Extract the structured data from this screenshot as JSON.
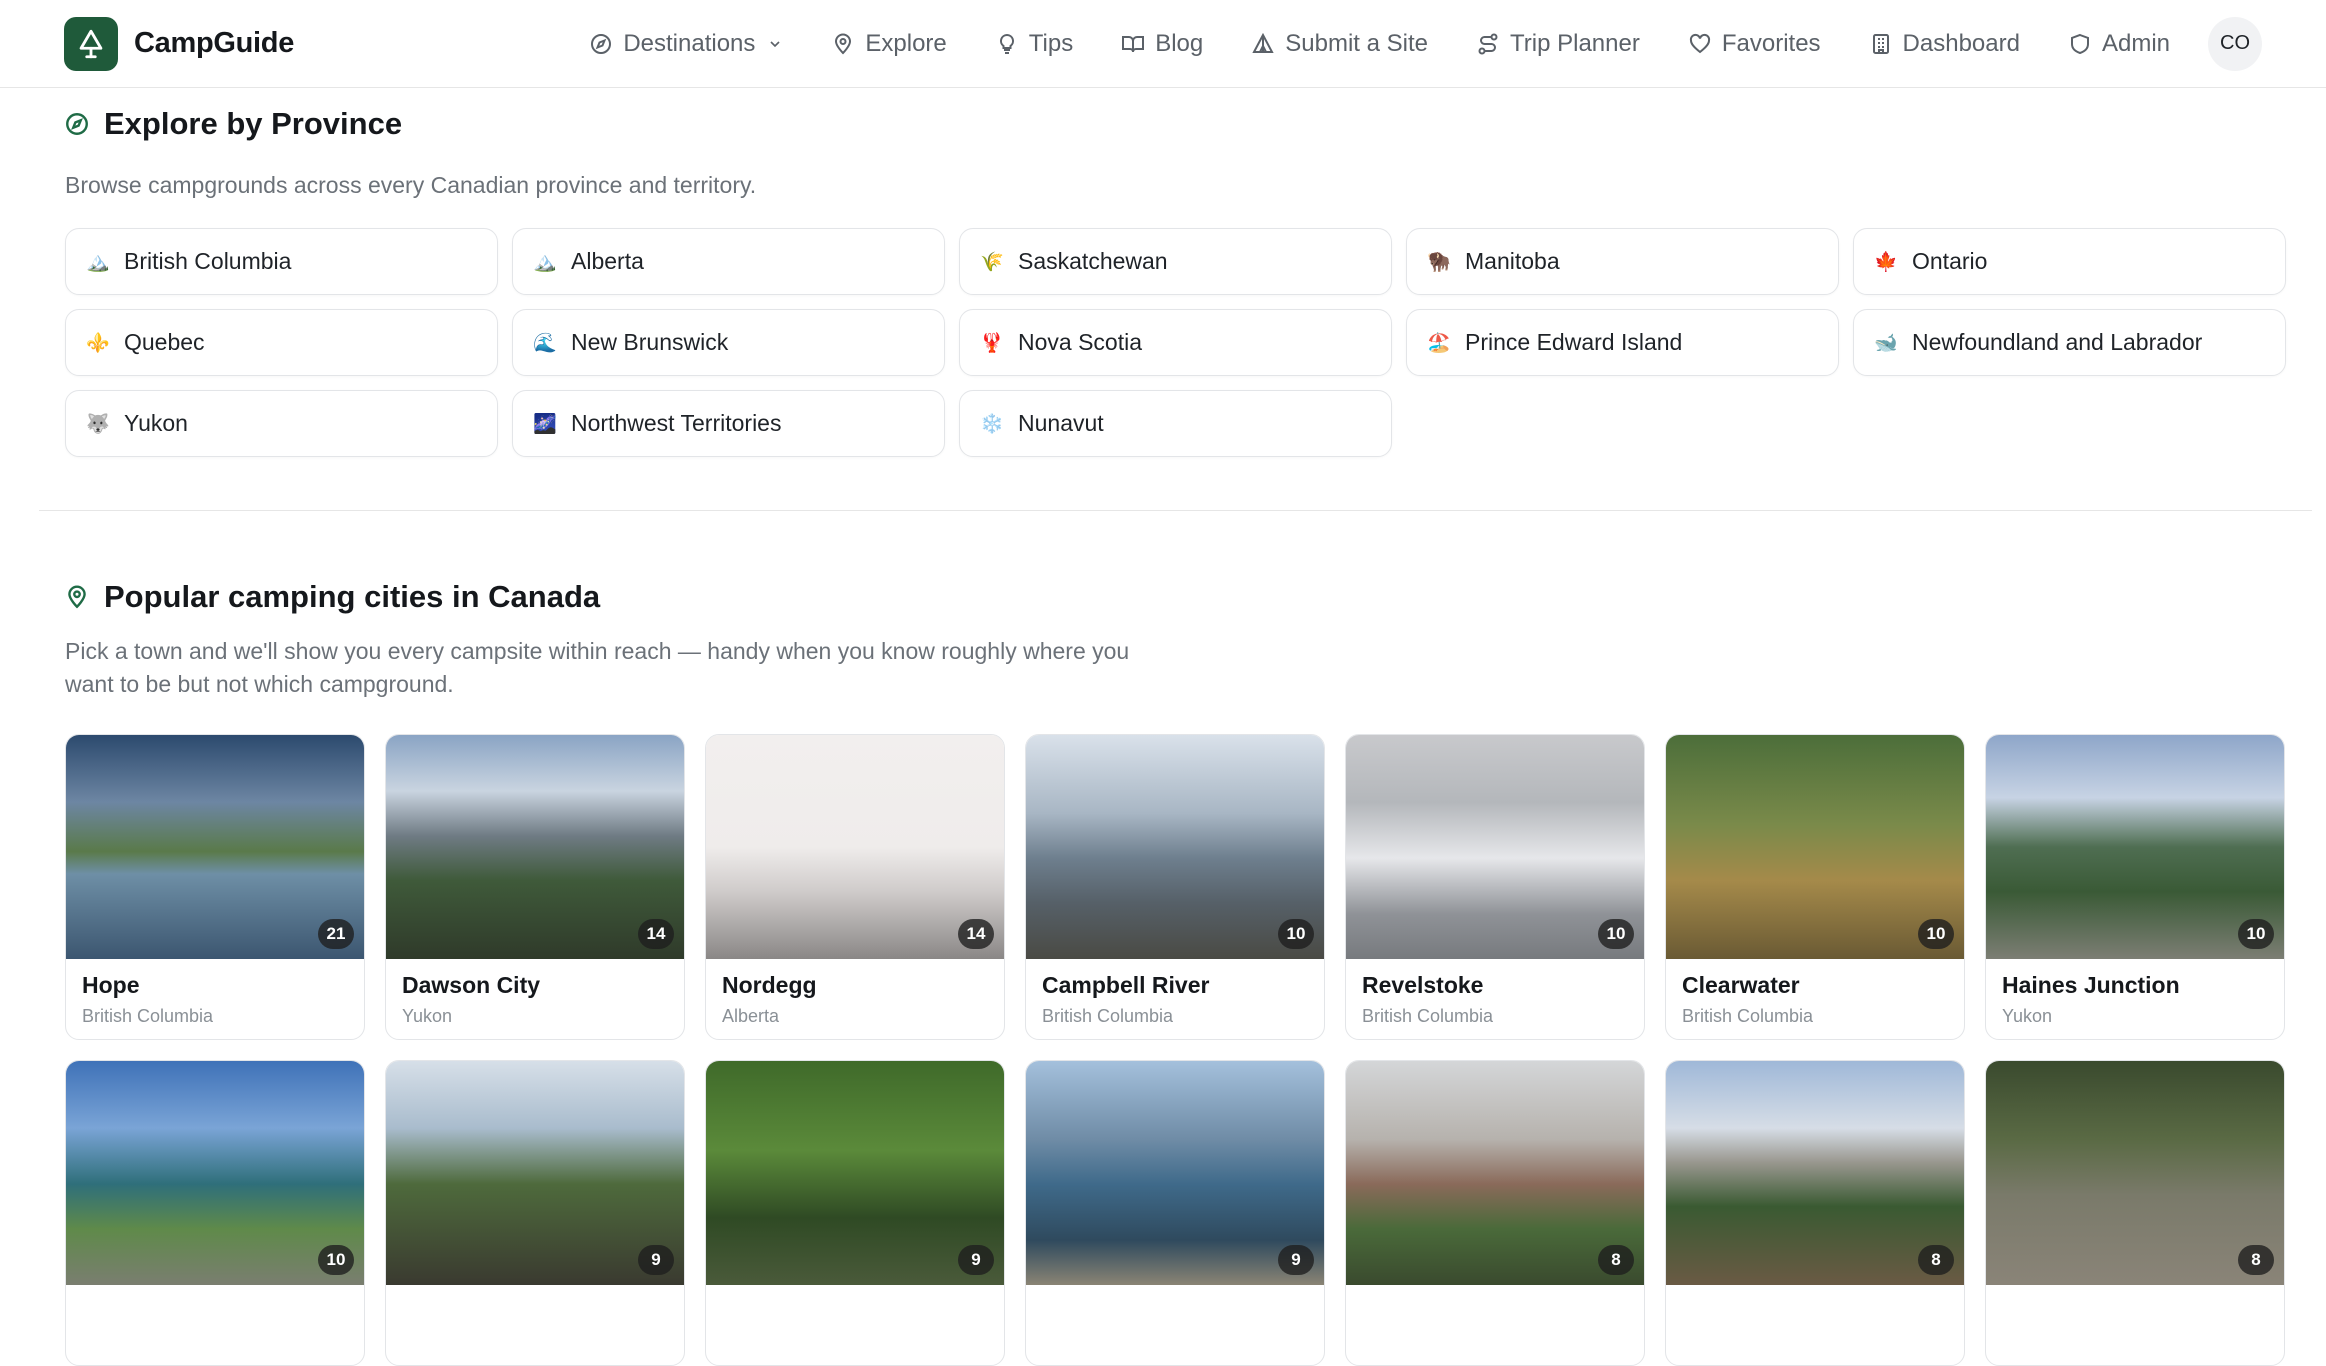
{
  "header": {
    "brand": "CampGuide",
    "nav": [
      {
        "label": "Destinations",
        "icon": "compass-icon",
        "has_dropdown": true
      },
      {
        "label": "Explore",
        "icon": "map-pin-icon"
      },
      {
        "label": "Tips",
        "icon": "lightbulb-icon"
      },
      {
        "label": "Blog",
        "icon": "book-icon"
      },
      {
        "label": "Submit a Site",
        "icon": "tent-icon"
      },
      {
        "label": "Trip Planner",
        "icon": "route-icon"
      },
      {
        "label": "Favorites",
        "icon": "heart-icon"
      },
      {
        "label": "Dashboard",
        "icon": "building-icon"
      },
      {
        "label": "Admin",
        "icon": "shield-icon"
      }
    ],
    "avatar_initials": "CO"
  },
  "province_section": {
    "title": "Explore by Province",
    "description": "Browse campgrounds across every Canadian province and territory.",
    "provinces": [
      {
        "emoji": "🏔️",
        "name": "British Columbia"
      },
      {
        "emoji": "🏔️",
        "name": "Alberta"
      },
      {
        "emoji": "🌾",
        "name": "Saskatchewan"
      },
      {
        "emoji": "🦬",
        "name": "Manitoba"
      },
      {
        "emoji": "🍁",
        "name": "Ontario"
      },
      {
        "emoji": "⚜️",
        "name": "Quebec"
      },
      {
        "emoji": "🌊",
        "name": "New Brunswick"
      },
      {
        "emoji": "🦞",
        "name": "Nova Scotia"
      },
      {
        "emoji": "🏖️",
        "name": "Prince Edward Island"
      },
      {
        "emoji": "🐋",
        "name": "Newfoundland and Labrador"
      },
      {
        "emoji": "🐺",
        "name": "Yukon"
      },
      {
        "emoji": "🌌",
        "name": "Northwest Territories"
      },
      {
        "emoji": "❄️",
        "name": "Nunavut"
      }
    ]
  },
  "cities_section": {
    "title": "Popular camping cities in Canada",
    "description_line1": "Pick a town and we'll show you every campsite within reach — handy when you know roughly where you",
    "description_line2": "want to be but not which campground.",
    "cities": [
      {
        "name": "Hope",
        "province": "British Columbia",
        "count": "21"
      },
      {
        "name": "Dawson City",
        "province": "Yukon",
        "count": "14"
      },
      {
        "name": "Nordegg",
        "province": "Alberta",
        "count": "14"
      },
      {
        "name": "Campbell River",
        "province": "British Columbia",
        "count": "10"
      },
      {
        "name": "Revelstoke",
        "province": "British Columbia",
        "count": "10"
      },
      {
        "name": "Clearwater",
        "province": "British Columbia",
        "count": "10"
      },
      {
        "name": "Haines Junction",
        "province": "Yukon",
        "count": "10"
      },
      {
        "name": "",
        "province": "",
        "count": "10"
      },
      {
        "name": "",
        "province": "",
        "count": "9"
      },
      {
        "name": "",
        "province": "",
        "count": "9"
      },
      {
        "name": "",
        "province": "",
        "count": "9"
      },
      {
        "name": "",
        "province": "",
        "count": "8"
      },
      {
        "name": "",
        "province": "",
        "count": "8"
      },
      {
        "name": "",
        "province": "",
        "count": "8"
      }
    ]
  },
  "colors": {
    "brand": "#1f5a3a",
    "accent_icon": "#1f6b46"
  }
}
